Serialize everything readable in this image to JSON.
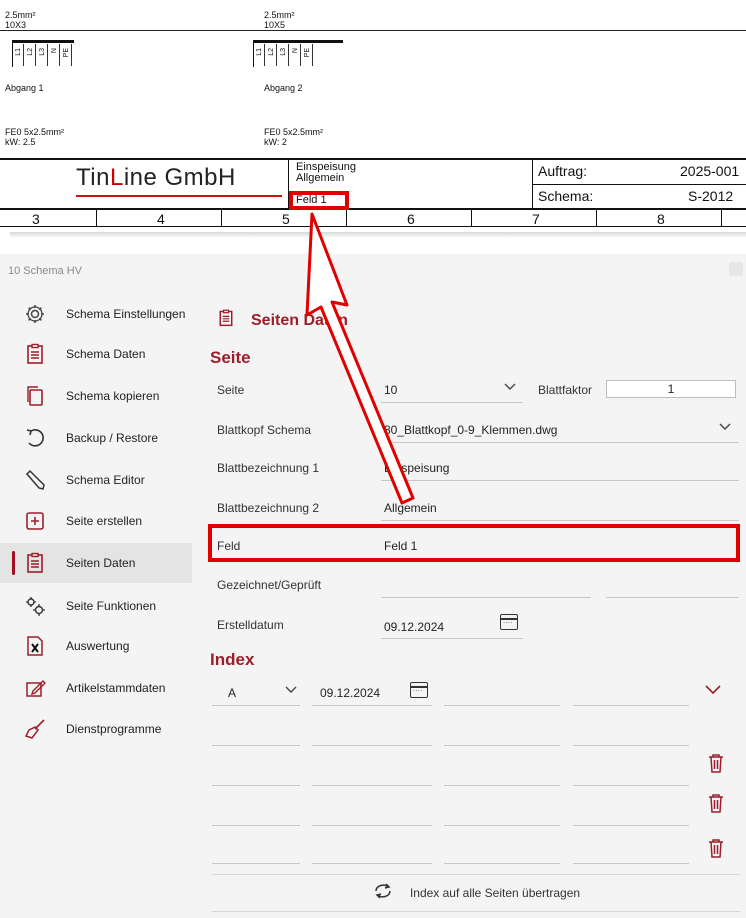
{
  "drawing": {
    "circuit1": {
      "cross_section": "2.5mm²",
      "cable": "10X3",
      "terminals": [
        "L1",
        "L2",
        "L3",
        "N",
        "PE"
      ],
      "name": "Abgang 1",
      "cable_type": "FE0 5x2.5mm²",
      "power": "kW: 2.5"
    },
    "circuit2": {
      "cross_section": "2.5mm²",
      "cable": "10X5",
      "terminals": [
        "L1",
        "L2",
        "L3",
        "N",
        "PE"
      ],
      "name": "Abgang 2",
      "cable_type": "FE0 5x2.5mm²",
      "power": "kW: 2"
    },
    "title_block": {
      "company_part1": "Tin",
      "company_part2": "L",
      "company_part3": "ine  GmbH",
      "desc1": "Einspeisung",
      "desc2": "Allgemein",
      "field": "Feld 1",
      "auftrag_label": "Auftrag:",
      "auftrag_value": "2025-001",
      "schema_label": "Schema:",
      "schema_value": "S-2012"
    },
    "column_numbers": [
      "3",
      "4",
      "5",
      "6",
      "7",
      "8"
    ]
  },
  "colors": {
    "accent": "#9b1f2a",
    "highlight": "#e00000"
  },
  "window": {
    "title": "10 Schema HV"
  },
  "sidebar": {
    "items": [
      {
        "label": "Schema Einstellungen",
        "icon": "gear-icon"
      },
      {
        "label": "Schema Daten",
        "icon": "clipboard-icon"
      },
      {
        "label": "Schema kopieren",
        "icon": "copy-icon"
      },
      {
        "label": "Backup / Restore",
        "icon": "restore-icon"
      },
      {
        "label": "Schema Editor",
        "icon": "pencil-icon"
      },
      {
        "label": "Seite erstellen",
        "icon": "add-page-icon"
      },
      {
        "label": "Seiten Daten",
        "icon": "clipboard-icon",
        "active": true
      },
      {
        "label": "Seite Funktionen",
        "icon": "gears-icon"
      },
      {
        "label": "Auswertung",
        "icon": "excel-icon"
      },
      {
        "label": "Artikelstammdaten",
        "icon": "edit-icon"
      },
      {
        "label": "Dienstprogramme",
        "icon": "broom-icon"
      }
    ]
  },
  "main": {
    "header_title": "Seiten Daten",
    "section_seite": "Seite",
    "fields": {
      "seite_label": "Seite",
      "seite_value": "10",
      "blattfaktor_label": "Blattfaktor",
      "blattfaktor_value": "1",
      "blattkopf_label": "Blattkopf Schema",
      "blattkopf_value": "80_Blattkopf_0-9_Klemmen.dwg",
      "bez1_label": "Blattbezeichnung 1",
      "bez1_value": "Einspeisung",
      "bez2_label": "Blattbezeichnung 2",
      "bez2_value": "Allgemein",
      "feld_label": "Feld",
      "feld_value": "Feld 1",
      "gezeichnet_label": "Gezeichnet/Geprüft",
      "erstelldatum_label": "Erstelldatum",
      "erstelldatum_value": "09.12.2024"
    },
    "section_index": "Index",
    "index_row": {
      "letter": "A",
      "date": "09.12.2024"
    },
    "footer_button": "Index auf alle Seiten übertragen"
  }
}
